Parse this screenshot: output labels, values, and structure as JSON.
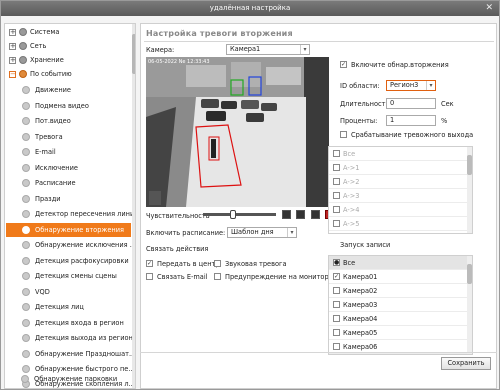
{
  "window": {
    "title": "удалённая настройка",
    "close_glyph": "✕"
  },
  "sidebar": {
    "groups": [
      {
        "label": "Система",
        "toggle": "+"
      },
      {
        "label": "Сеть",
        "toggle": "+"
      },
      {
        "label": "Хранение",
        "toggle": "+"
      },
      {
        "label": "По событию",
        "toggle": "−"
      }
    ],
    "items": [
      {
        "label": "Движение"
      },
      {
        "label": "Подмена видео"
      },
      {
        "label": "Пот.видео"
      },
      {
        "label": "Тревога"
      },
      {
        "label": "E-mail"
      },
      {
        "label": "Исключение"
      },
      {
        "label": "Расписание"
      },
      {
        "label": "Празди"
      },
      {
        "label": "Детектор пересечения линии"
      },
      {
        "label": "Обнаружение вторжения"
      },
      {
        "label": "Обнаружение исключения ..."
      },
      {
        "label": "Детекция расфокусировки"
      },
      {
        "label": "Детекция смены сцены"
      },
      {
        "label": "VQD"
      },
      {
        "label": "Детекция лиц"
      },
      {
        "label": "Детекция входа в регион"
      },
      {
        "label": "Детекция выхода из региона"
      },
      {
        "label": "Обнаружение Праздношат..."
      },
      {
        "label": "Обнаружение быстрого пе..."
      },
      {
        "label": "Обнаружение скопления л..."
      },
      {
        "label": "Обнаружение парковки"
      }
    ],
    "selected_index": 9
  },
  "main": {
    "heading": "Настройка тревоги вторжения",
    "camera_label": "Камера:",
    "camera_value": "Камера1",
    "video": {
      "timestamp": "06-05-2022 Ne 12:33:43"
    },
    "sensitivity_label": "Чувствительность",
    "sensitivity_value": 80,
    "schedule_label": "Включить расписание:",
    "schedule_value": "Шаблон дня",
    "link_actions_title": "Связать действия",
    "actions": [
      {
        "label": "Передать в центр",
        "checked": true
      },
      {
        "label": "Звуковая тревога",
        "checked": false
      },
      {
        "label": "Связать E-mail",
        "checked": false
      },
      {
        "label": "Предупреждение на мониторе",
        "checked": false
      }
    ],
    "enable_detection_label": "Включите обнар.вторжения",
    "enable_detection_checked": true,
    "region_id_label": "ID области:",
    "region_id_value": "Регион3",
    "duration_label": "Длительность:",
    "duration_value": "0",
    "duration_unit": "Сек",
    "percent_label": "Проценты:",
    "percent_value": "1",
    "percent_unit": "%",
    "alarm_output_label": "Срабатывание тревожного выхода",
    "alarm_outputs": [
      {
        "label": "Все"
      },
      {
        "label": "A->1"
      },
      {
        "label": "A->2"
      },
      {
        "label": "A->3"
      },
      {
        "label": "A->4"
      },
      {
        "label": "A->5"
      }
    ],
    "record_title": "Запуск записи",
    "record_items": [
      {
        "label": "Все",
        "selected": true
      },
      {
        "label": "Камера01",
        "checked": true
      },
      {
        "label": "Камера02",
        "checked": false
      },
      {
        "label": "Камера03",
        "checked": false
      },
      {
        "label": "Камера04",
        "checked": false
      },
      {
        "label": "Камера05",
        "checked": false
      },
      {
        "label": "Камера06",
        "checked": false
      }
    ],
    "save_label": "Сохранить"
  }
}
